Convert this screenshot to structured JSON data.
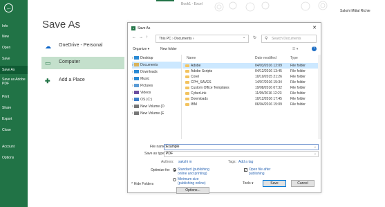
{
  "window": {
    "doc_title": "Book1 - Excel",
    "user_name": "Sakshi Mittal Richie"
  },
  "sidebar": {
    "items": [
      "Info",
      "New",
      "Open",
      "Save",
      "Save As",
      "Save as Adobe PDF",
      "Print",
      "Share",
      "Export",
      "Close",
      "Account",
      "Options"
    ],
    "active": "Save As"
  },
  "main": {
    "title": "Save As",
    "places": [
      {
        "label": "OneDrive - Personal",
        "icon": "cloud-icon"
      },
      {
        "label": "Computer",
        "icon": "computer-icon"
      },
      {
        "label": "Add a Place",
        "icon": "plus-icon"
      }
    ]
  },
  "dialog": {
    "title": "Save As",
    "breadcrumb": "This PC › Documents ›",
    "search_placeholder": "Search Documents",
    "toolbar": {
      "organize": "Organize ▾",
      "new_folder": "New folder"
    },
    "tree": [
      "Desktop",
      "Documents",
      "Downloads",
      "Music",
      "Pictures",
      "Videos",
      "OS (C:)",
      "New Volume (D",
      "New Volume (E"
    ],
    "columns": {
      "name": "Name",
      "date": "Date modified",
      "type": "Type"
    },
    "files": [
      {
        "name": "Adobe",
        "date": "04/03/2016 12:09",
        "type": "File folder"
      },
      {
        "name": "Adobe Scripts",
        "date": "04/12/2016 13:45",
        "type": "File folder"
      },
      {
        "name": "Corel",
        "date": "10/10/2015 21:26",
        "type": "File folder"
      },
      {
        "name": "CPH_SAVES",
        "date": "14/07/2016 15:34",
        "type": "File folder"
      },
      {
        "name": "Custom Office Templates",
        "date": "19/08/2016 07:32",
        "type": "File folder"
      },
      {
        "name": "CyberLink",
        "date": "11/05/2016 12:23",
        "type": "File folder"
      },
      {
        "name": "Downloads",
        "date": "10/12/2016 17:45",
        "type": "File folder"
      },
      {
        "name": "IBM",
        "date": "06/04/2016 15:09",
        "type": "File folder"
      }
    ],
    "file_name_label": "File name:",
    "file_name_value": "Example",
    "save_type_label": "Save as type:",
    "save_type_value": "PDF",
    "authors_label": "Authors:",
    "authors_value": "sakshi m",
    "tags_label": "Tags:",
    "tags_value": "Add a tag",
    "optimize_label": "Optimize for:",
    "opt_standard": "Standard (publishing online and printing)",
    "opt_minimum": "Minimum size (publishing online)",
    "open_after": "Open file after publishing",
    "options_button": "Options...",
    "hide_folders": "Hide Folders",
    "tools": "Tools ▾",
    "save": "Save",
    "cancel": "Cancel"
  },
  "colors": {
    "accent": "#217346",
    "selection": "#cce8ff"
  }
}
